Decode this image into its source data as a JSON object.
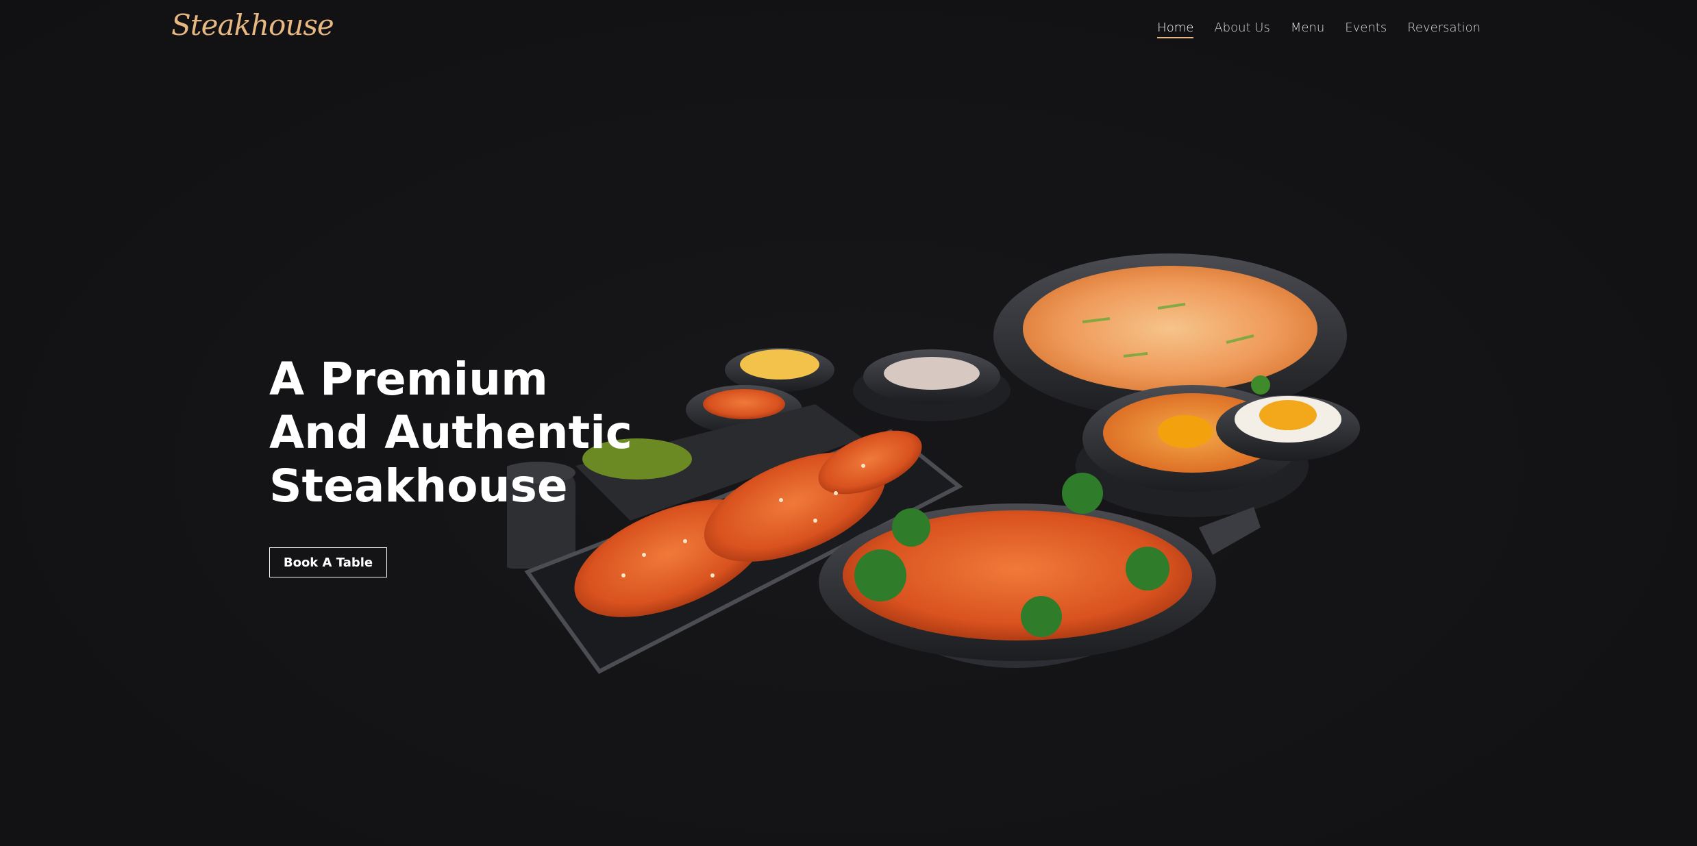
{
  "brand": {
    "logo_text": "Steakhouse",
    "accent_color": "#e8b883"
  },
  "nav": {
    "items": [
      {
        "label": "Home",
        "active": true
      },
      {
        "label": "About Us",
        "active": false
      },
      {
        "label": "Menu",
        "active": false
      },
      {
        "label": "Events",
        "active": false
      },
      {
        "label": "Reversation",
        "active": false
      }
    ]
  },
  "hero": {
    "title_lines": [
      "A Premium",
      "And Authentic",
      "Steakhouse"
    ],
    "cta_label": "Book A Table",
    "image_description_icon": "food-spread-image"
  }
}
